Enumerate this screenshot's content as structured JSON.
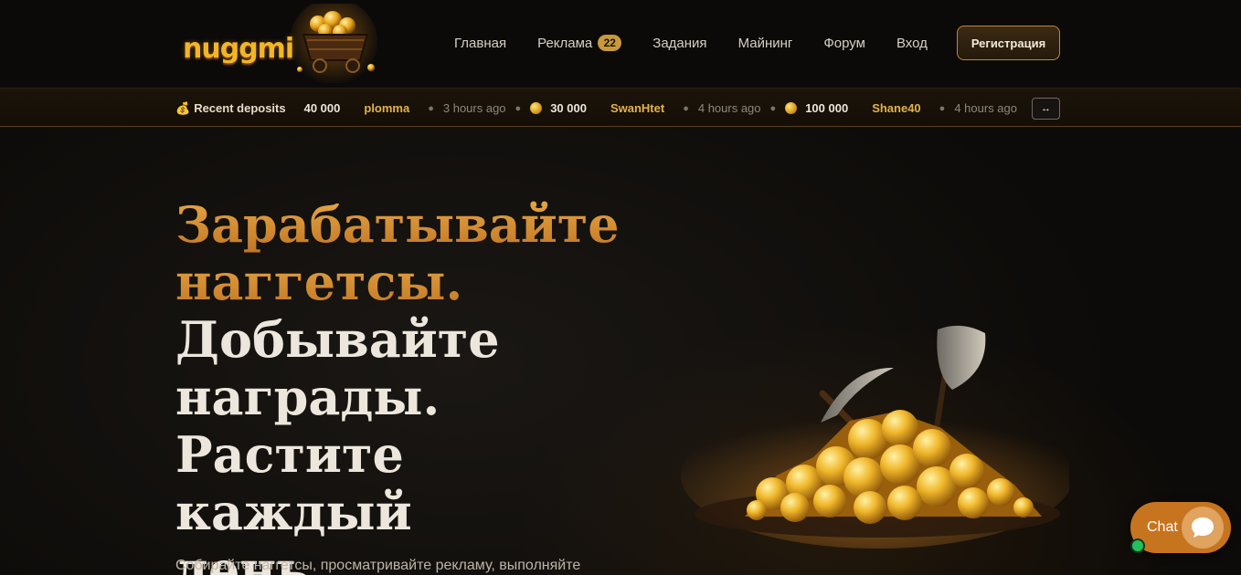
{
  "header": {
    "logo_text": "nuggmi",
    "nav": [
      {
        "label": "Главная"
      },
      {
        "label": "Реклама",
        "badge": "22"
      },
      {
        "label": "Задания"
      },
      {
        "label": "Майнинг"
      },
      {
        "label": "Форум"
      },
      {
        "label": "Вход"
      }
    ],
    "register_label": "Регистрация"
  },
  "ticker": {
    "label": "Recent deposits",
    "first_amount": "40 000",
    "entries": [
      {
        "user": "plomma",
        "time": "3 hours ago",
        "amount": "30 000"
      },
      {
        "user": "SwanHtet",
        "time": "4 hours ago",
        "amount": "100 000"
      },
      {
        "user": "Shane40",
        "time": "4 hours ago"
      }
    ],
    "toggle_label": "↔"
  },
  "hero": {
    "title_gold": [
      "Зарабатывайте",
      "наггетсы."
    ],
    "title_white": [
      "Добывайте",
      "награды.",
      "Растите каждый",
      "день."
    ],
    "subtitle": "Собирайте наггетсы, просматривайте рекламу, выполняйте"
  },
  "chat": {
    "label": "Chat"
  },
  "colors": {
    "accent_gold": "#e3b24e",
    "chat_orange": "#c7741f",
    "online_green": "#22c15e",
    "background": "#0d0b09"
  }
}
